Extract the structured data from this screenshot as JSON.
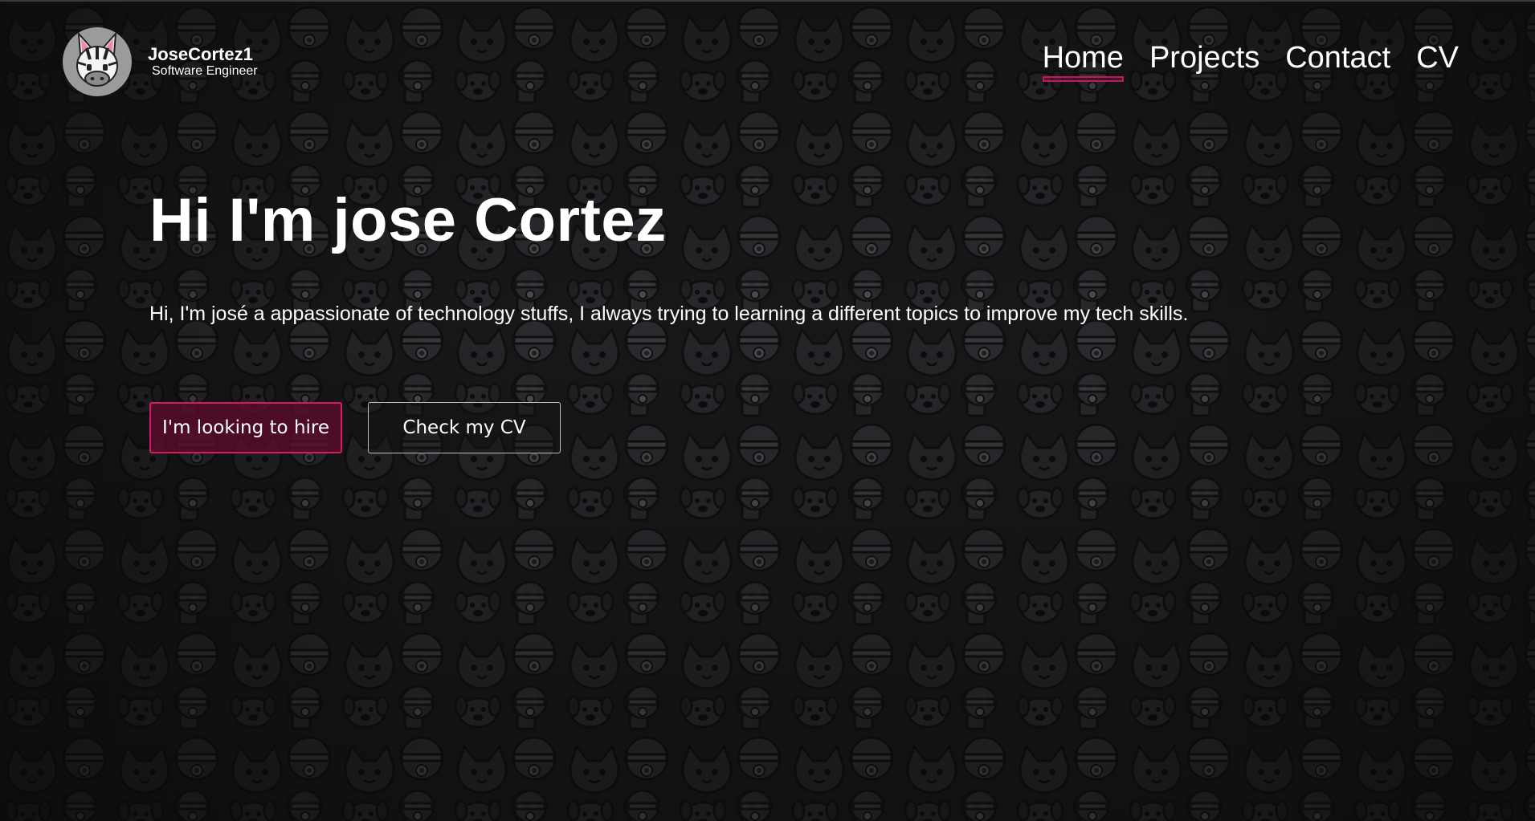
{
  "header": {
    "brand_name": "JoseCortez1",
    "brand_role": "Software Engineer",
    "avatar_icon": "zebra-icon"
  },
  "nav": {
    "items": [
      {
        "label": "Home",
        "active": true
      },
      {
        "label": "Projects",
        "active": false
      },
      {
        "label": "Contact",
        "active": false
      },
      {
        "label": "CV",
        "active": false
      }
    ]
  },
  "hero": {
    "title": "Hi I'm jose Cortez",
    "intro": "Hi, I'm josé a appassionate of technology stuffs, I always trying to learning a different topics to improve my tech skills.",
    "hire_button": "I'm looking to hire",
    "cv_button": "Check my CV"
  },
  "colors": {
    "accent": "#d81b60",
    "background": "#18181a",
    "text": "#ffffff"
  }
}
